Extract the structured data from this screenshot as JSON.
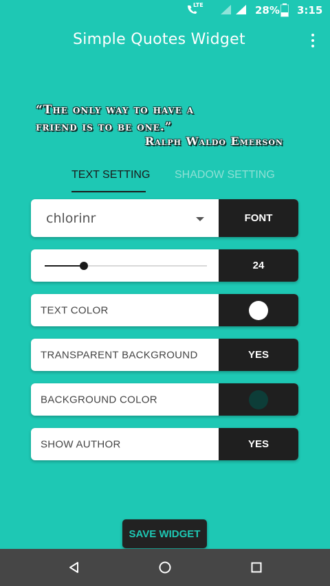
{
  "status_bar": {
    "network_label": "LTE",
    "battery": "28%",
    "time": "3:15"
  },
  "app": {
    "title": "Simple Quotes Widget"
  },
  "quote": {
    "text_line1": "“The only way to have a",
    "text_line2": "friend is to be one.”",
    "author": "Ralph Waldo Emerson"
  },
  "tabs": [
    {
      "label": "TEXT SETTING",
      "active": true
    },
    {
      "label": "SHADOW SETTING",
      "active": false
    }
  ],
  "settings": {
    "font": {
      "value": "chlorinr",
      "button": "FONT"
    },
    "size": {
      "value": "24",
      "slider_fraction": 0.24
    },
    "text_color": {
      "label": "TEXT COLOR",
      "color": "#ffffff"
    },
    "transparent_background": {
      "label": "TRANSPARENT BACKGROUND",
      "value": "YES"
    },
    "background_color": {
      "label": "BACKGROUND COLOR",
      "color": "#0d3d38"
    },
    "show_author": {
      "label": "SHOW AUTHOR",
      "value": "YES"
    }
  },
  "actions": {
    "save_label": "SAVE WIDGET"
  },
  "colors": {
    "accent": "#1ec8b4",
    "dark": "#1f1f1f"
  },
  "icons": {
    "back": "back-triangle-icon",
    "home": "home-circle-icon",
    "recents": "recents-square-icon",
    "overflow": "more-vert-icon"
  }
}
